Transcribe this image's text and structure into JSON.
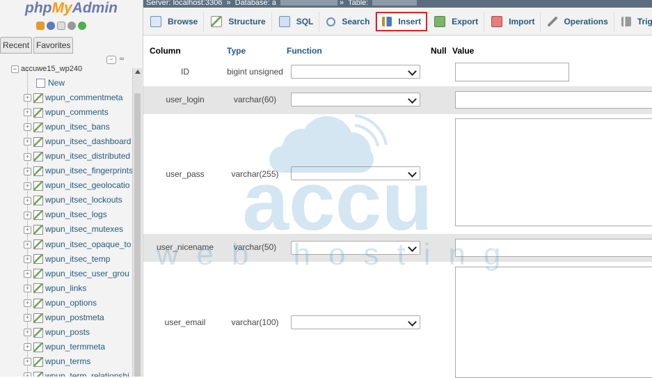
{
  "sidebar": {
    "logo_php": "php",
    "logo_my": "My",
    "logo_admin": "Admin",
    "tabs": [
      "Recent",
      "Favorites"
    ],
    "database": "accuwe15_wp240",
    "new_label": "New",
    "tables": [
      "wpun_commentmeta",
      "wpun_comments",
      "wpun_itsec_bans",
      "wpun_itsec_dashboard",
      "wpun_itsec_distributed",
      "wpun_itsec_fingerprints",
      "wpun_itsec_geolocatio",
      "wpun_itsec_lockouts",
      "wpun_itsec_logs",
      "wpun_itsec_mutexes",
      "wpun_itsec_opaque_to",
      "wpun_itsec_temp",
      "wpun_itsec_user_grou",
      "wpun_links",
      "wpun_options",
      "wpun_postmeta",
      "wpun_posts",
      "wpun_termmeta",
      "wpun_terms",
      "wpun_term_relationshi"
    ]
  },
  "breadcrumb": {
    "server": "Server: localhost:3306",
    "database": "Database: a",
    "table": "Table:"
  },
  "nav": {
    "tabs": [
      "Browse",
      "Structure",
      "SQL",
      "Search",
      "Insert",
      "Export",
      "Import",
      "Operations",
      "Trig"
    ],
    "active": "Insert"
  },
  "form": {
    "headers": {
      "column": "Column",
      "type": "Type",
      "function": "Function",
      "null": "Null",
      "value": "Value"
    },
    "rows": [
      {
        "name": "ID",
        "type": "bigint unsigned"
      },
      {
        "name": "user_login",
        "type": "varchar(60)"
      },
      {
        "name": "user_pass",
        "type": "varchar(255)"
      },
      {
        "name": "user_nicename",
        "type": "varchar(50)"
      },
      {
        "name": "user_email",
        "type": "varchar(100)"
      }
    ]
  },
  "watermark": {
    "brand": "accu",
    "sub": "web hosting"
  },
  "colors": {
    "accent": "#235a81",
    "active_border": "#dd2222",
    "watermark": "#3d8fc7"
  }
}
